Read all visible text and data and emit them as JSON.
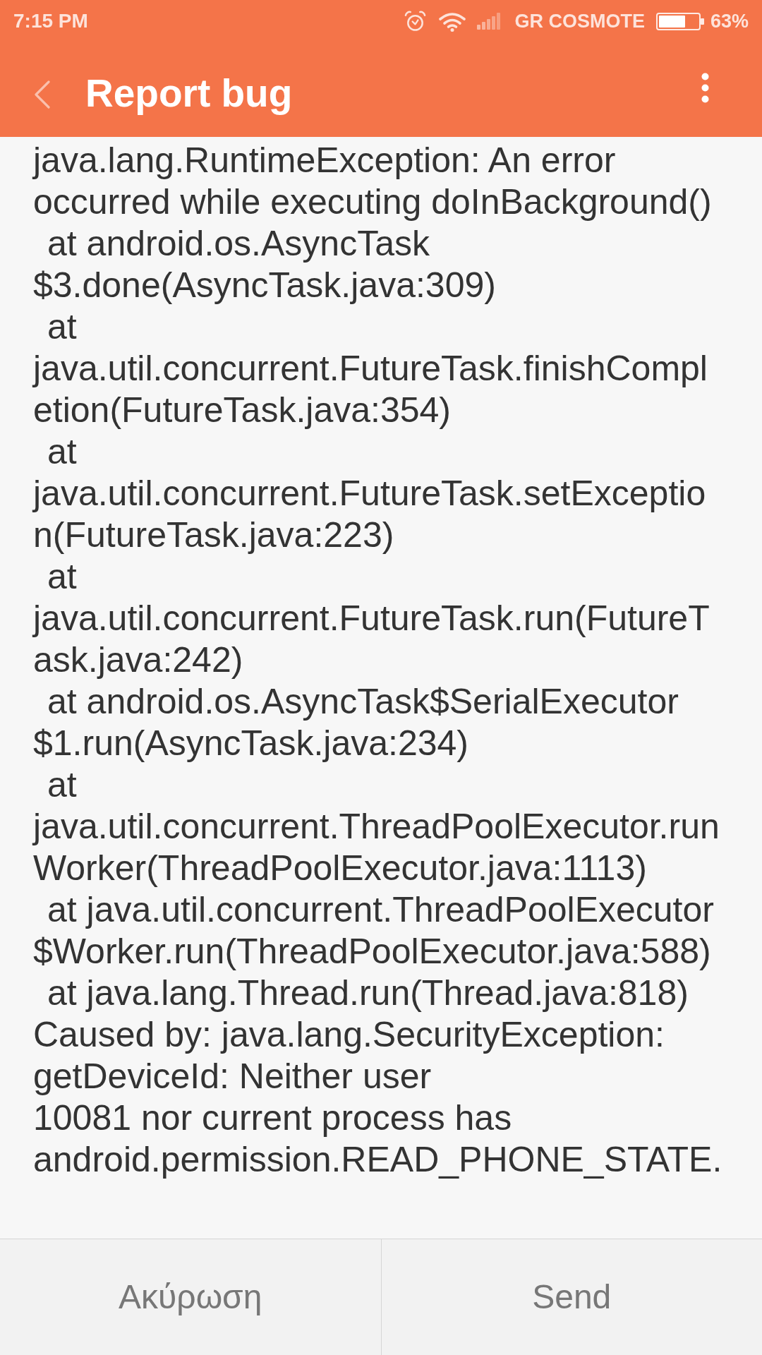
{
  "status_bar": {
    "time": "7:15 PM",
    "carrier": "GR COSMOTE",
    "battery_percent": "63%"
  },
  "app_bar": {
    "title": "Report bug"
  },
  "report": {
    "lines": [
      {
        "text": "java.lang.RuntimeException: An error",
        "indented": false
      },
      {
        "text": "occurred while executing doInBackground()",
        "indented": false
      },
      {
        "text": "at android.os.AsyncTask",
        "indented": true
      },
      {
        "text": "$3.done(AsyncTask.java:309)",
        "indented": false
      },
      {
        "text": "at",
        "indented": true
      },
      {
        "text": "java.util.concurrent.FutureTask.finishCompl",
        "indented": false
      },
      {
        "text": "etion(FutureTask.java:354)",
        "indented": false
      },
      {
        "text": "at",
        "indented": true
      },
      {
        "text": "java.util.concurrent.FutureTask.setExceptio",
        "indented": false
      },
      {
        "text": "n(FutureTask.java:223)",
        "indented": false
      },
      {
        "text": "at",
        "indented": true
      },
      {
        "text": "java.util.concurrent.FutureTask.run(FutureT",
        "indented": false
      },
      {
        "text": "ask.java:242)",
        "indented": false
      },
      {
        "text": "at android.os.AsyncTask$SerialExecutor",
        "indented": true
      },
      {
        "text": "$1.run(AsyncTask.java:234)",
        "indented": false
      },
      {
        "text": "at",
        "indented": true
      },
      {
        "text": "java.util.concurrent.ThreadPoolExecutor.run",
        "indented": false
      },
      {
        "text": "Worker(ThreadPoolExecutor.java:1113)",
        "indented": false
      },
      {
        "text": "at java.util.concurrent.ThreadPoolExecutor",
        "indented": true
      },
      {
        "text": "$Worker.run(ThreadPoolExecutor.java:588)",
        "indented": false
      },
      {
        "text": "at java.lang.Thread.run(Thread.java:818)",
        "indented": true
      },
      {
        "text": "Caused by: java.lang.SecurityException:",
        "indented": false
      },
      {
        "text": "getDeviceId: Neither user",
        "indented": false
      },
      {
        "text": "10081 nor current process has",
        "indented": false
      },
      {
        "text": "android.permission.READ_PHONE_STATE.",
        "indented": false
      }
    ]
  },
  "buttons": [
    {
      "label": "Ακύρωση"
    },
    {
      "label": "Send"
    }
  ]
}
